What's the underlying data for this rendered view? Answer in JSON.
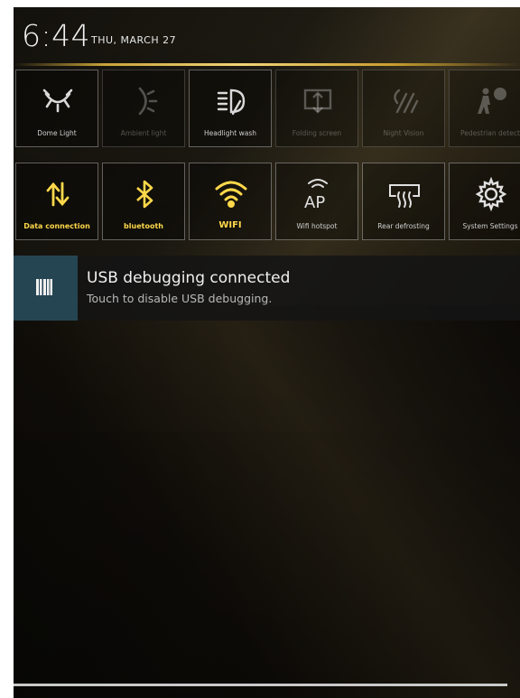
{
  "status": {
    "time": "6:44",
    "date": "THU, MARCH 27"
  },
  "quick_tiles_row1": [
    {
      "label": "Dome Light",
      "icon": "dome-light-icon",
      "state": "enabled"
    },
    {
      "label": "Ambient light",
      "icon": "ambient-light-icon",
      "state": "disabled"
    },
    {
      "label": "Headlight wash",
      "icon": "headlight-wash-icon",
      "state": "enabled"
    },
    {
      "label": "Folding screen",
      "icon": "folding-screen-icon",
      "state": "disabled"
    },
    {
      "label": "Night Vision",
      "icon": "night-vision-icon",
      "state": "disabled"
    },
    {
      "label": "Pedestrian detect",
      "icon": "pedestrian-alert-icon",
      "state": "disabled"
    }
  ],
  "quick_tiles_row2": [
    {
      "label": "Data connection",
      "icon": "data-connection-icon",
      "state": "on"
    },
    {
      "label": "bluetooth",
      "icon": "bluetooth-icon",
      "state": "on"
    },
    {
      "label": "WIFI",
      "icon": "wifi-icon",
      "state": "on"
    },
    {
      "label": "Wifi hotspot",
      "icon": "wifi-hotspot-icon",
      "state": "off"
    },
    {
      "label": "Rear defrosting",
      "icon": "rear-defrost-icon",
      "state": "off"
    },
    {
      "label": "System Settings",
      "icon": "settings-gear-icon",
      "state": "off"
    }
  ],
  "notification": {
    "title": "USB debugging connected",
    "subtitle": "Touch to disable USB debugging.",
    "icon": "usb-debug-icon"
  },
  "colors": {
    "accent_on": "#ffd84a",
    "gold_line": "#f3d476",
    "notif_icon_bg": "#264552"
  }
}
